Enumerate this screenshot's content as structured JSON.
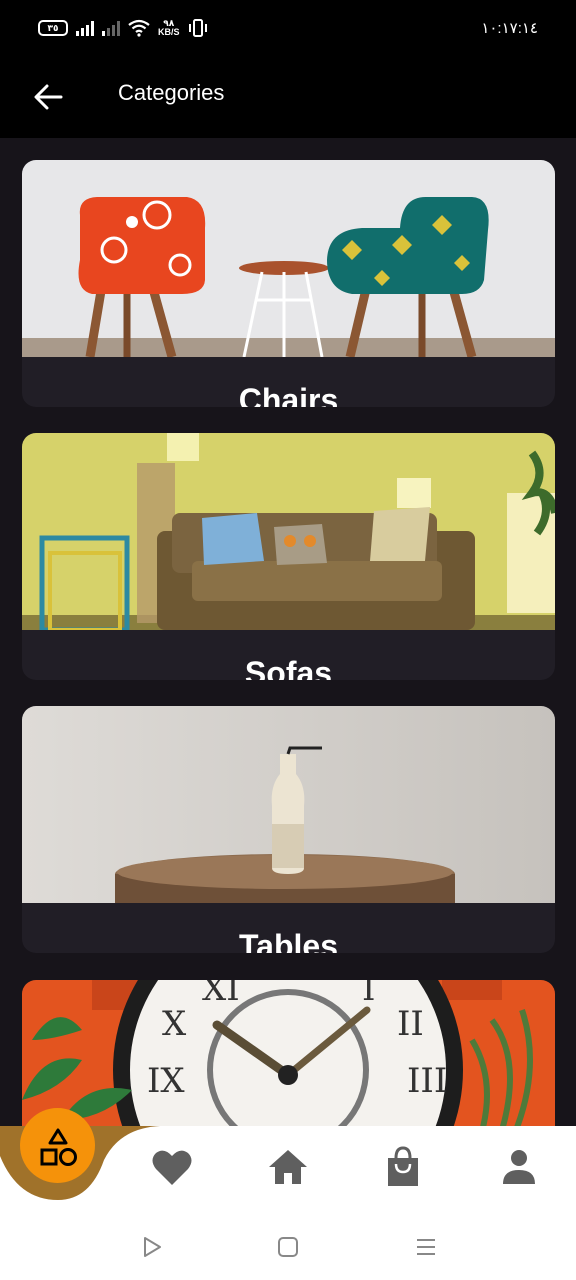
{
  "status_bar": {
    "battery": "٣٥",
    "net_speed_value": "٩٨",
    "net_speed_unit": "KB/S",
    "time": "١٠:١٧:١٤"
  },
  "app_bar": {
    "title": "Categories",
    "back_icon": "arrow-left-icon"
  },
  "categories": [
    {
      "label": "Chairs",
      "image": "two-patterned-armchairs-photo"
    },
    {
      "label": "Sofas",
      "image": "living-room-sofa-photo"
    },
    {
      "label": "Tables",
      "image": "round-wooden-table-with-bottle-photo"
    },
    {
      "label": "",
      "image": "wall-clock-with-plants-photo"
    }
  ],
  "bottom_nav": {
    "active_item": "categories",
    "items": [
      "shapes-icon",
      "heart-icon",
      "home-icon",
      "shopping-bag-icon",
      "person-icon"
    ],
    "accent_color": "#f5920a",
    "notch_color": "#a0722a"
  },
  "system_nav": {
    "items": [
      "back-triangle-icon",
      "home-square-icon",
      "recents-menu-icon"
    ]
  }
}
